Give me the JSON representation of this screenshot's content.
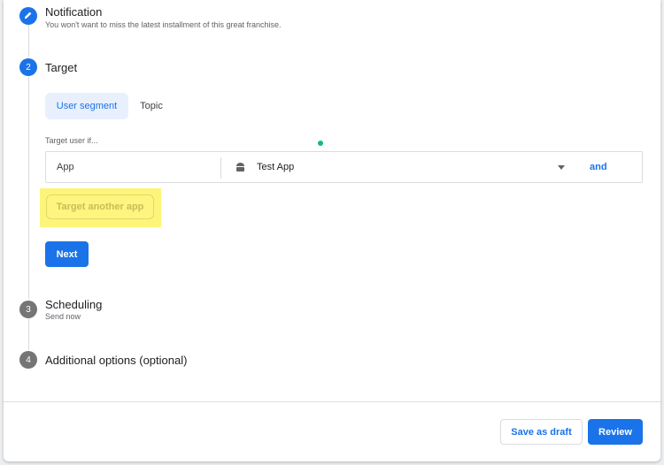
{
  "steps": [
    {
      "number": "",
      "title": "Notification",
      "subtitle": "You won't want to miss the latest installment of this great franchise."
    },
    {
      "number": "2",
      "title": "Target",
      "subtitle": ""
    },
    {
      "number": "3",
      "title": "Scheduling",
      "subtitle": "Send now"
    },
    {
      "number": "4",
      "title": "Additional options (optional)",
      "subtitle": ""
    }
  ],
  "target": {
    "tabs": [
      {
        "label": "User segment",
        "active": true
      },
      {
        "label": "Topic",
        "active": false
      }
    ],
    "condition_label": "Target user if...",
    "row": {
      "field": "App",
      "app_icon": "android-icon",
      "app_value": "Test App",
      "and_label": "and"
    },
    "another_app_label": "Target another app",
    "next_label": "Next"
  },
  "footer": {
    "save_draft_label": "Save as draft",
    "review_label": "Review"
  },
  "colors": {
    "accent": "#1a73e8",
    "highlight": "#fcf579",
    "step_inactive": "#757575"
  }
}
